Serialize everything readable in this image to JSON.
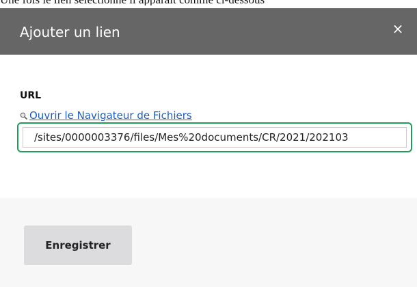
{
  "page": {
    "caption_text": "Une fois le lien sélectionné il apparaît comme ci-dessous"
  },
  "dialog": {
    "title": "Ajouter un lien",
    "close_symbol": "×",
    "close_icon": "close-icon"
  },
  "form": {
    "url_label": "URL",
    "browse_link_text": "Ouvrir le Navigateur de Fichiers",
    "browse_icon": "magnifier-icon",
    "url_value": "/sites/0000003376/files/Mes%20documents/CR/2021/202103"
  },
  "footer": {
    "save_label": "Enregistrer"
  },
  "colors": {
    "header_bg": "#666666",
    "focus_border": "#1f9b5a",
    "link": "#1a5dc4",
    "button_bg": "#dcdcdf",
    "footer_bg": "#f7f7f7"
  }
}
